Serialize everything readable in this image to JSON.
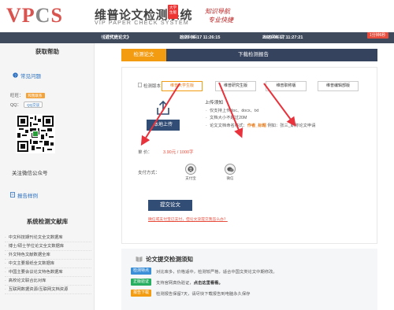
{
  "header": {
    "logo_main": "VP",
    "logo_accent": "C",
    "logo_tail": "S",
    "brand_cn": "维普论文检测系统",
    "brand_en": "VIP PAPER CHECK SYSTEM",
    "edition_badge": "大学生版",
    "slogan_line1": "知识导航",
    "slogan_line2": "专业快捷"
  },
  "infobar": {
    "doc_label": "检测文档：",
    "doc_value": "《近代史论文》",
    "time_label": "检测时间：",
    "time_value": "2020-06-17 11:26:15",
    "report_label": "出结果时间：",
    "report_value": "2020-06-17 11:27:21",
    "duration": "1分钟6秒"
  },
  "sidebar": {
    "help_title": "获取帮助",
    "faq_link": "常见问题",
    "wangwang_label": "旺旺：",
    "wangwang_badge": "和我联系",
    "qq_label": "QQ：",
    "qq_badge": "QQ交谈",
    "qr_caption": "关注微信公众号",
    "report_link": "报告样例",
    "db_title": "系统检测文献库",
    "databases": [
      "中文科技期刊论文全文数据库",
      "博士/硕士学位论文全文数据库",
      "外文特色文献数据全库",
      "中文主要报纸全文数据库",
      "中国主要会议论文特色数据库",
      "高校论文联合比对库",
      "互联网数据资源/互联网文档资源"
    ]
  },
  "main": {
    "tab_active": "检测论文",
    "tab_download": "下载检测报告",
    "version_label": "检测版本：",
    "versions": [
      "维普大学生版",
      "维普研究生版",
      "维普职称版",
      "维普编辑部版"
    ],
    "upload_button": "本地上传",
    "notice_title": "上传须知",
    "notice_items": [
      "仅支持上传doc、docx、txt",
      "文档大小不超过20M",
      "论文文档命名格式："
    ],
    "notice_format_bold": "作者_标题",
    "notice_format_example": "例如：张三_职称论文申请",
    "price_label": "单   价：",
    "price_value": "3.90元 / 1000字",
    "pay_label": "支付方式：",
    "pay_alipay": "支付宝",
    "pay_wechat": "微信",
    "submit_button": "提交论文",
    "warn_link": "微信或支付宝已支付，但论文没提交我怎么办？"
  },
  "notice_box": {
    "title": "论文提交检测须知",
    "rows": [
      {
        "badge": "检测特点",
        "color": "#3b8fd8",
        "text": "对比库多，价格适中，检测较严格，适合中国文类论文中期修改。",
        "strong": ""
      },
      {
        "badge": "正版验证",
        "color": "#27ae60",
        "text": "支持官网真伪验证，",
        "strong": "点击这里看看。"
      },
      {
        "badge": "报告下载",
        "color": "#f39c12",
        "text": "检测报告保留7天，请尽快下载报告到电脑永久保存",
        "strong": ""
      }
    ]
  }
}
